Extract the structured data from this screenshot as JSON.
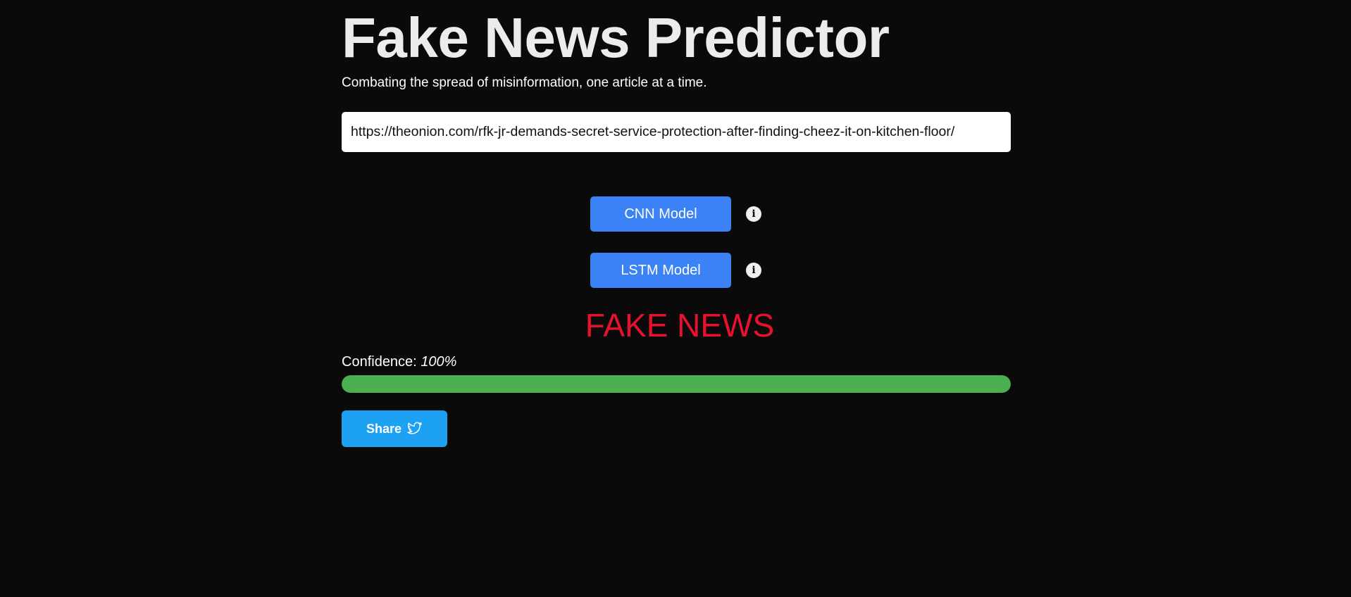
{
  "header": {
    "title": "Fake News Predictor",
    "subtitle": "Combating the spread of misinformation, one article at a time."
  },
  "url_input": {
    "value": "https://theonion.com/rfk-jr-demands-secret-service-protection-after-finding-cheez-it-on-kitchen-floor/"
  },
  "models": {
    "cnn_label": "CNN Model",
    "lstm_label": "LSTM Model",
    "info_icon": "info-icon"
  },
  "result": {
    "verdict": "FAKE NEWS",
    "confidence_label": "Confidence:",
    "confidence_value": "100%",
    "confidence_fraction": 1.0
  },
  "share": {
    "label": "Share",
    "icon": "twitter-icon"
  },
  "colors": {
    "background": "#0a0a0b",
    "button_blue": "#3b82f6",
    "verdict_red": "#e8112d",
    "progress_green": "#4caf50",
    "share_blue": "#1da1f2"
  }
}
